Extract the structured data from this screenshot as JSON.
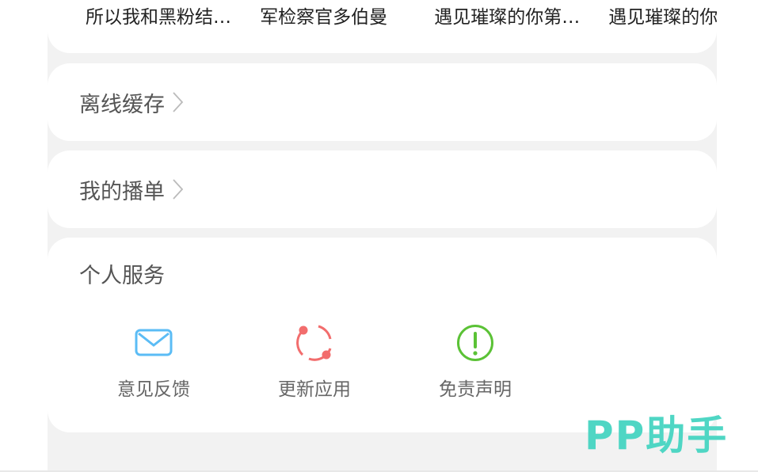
{
  "history": {
    "items": [
      "所以我和黑粉结婚了",
      "军检察官多伯曼",
      "遇见璀璨的你第一季",
      "遇见璀璨的你"
    ]
  },
  "menu": {
    "offline_label": "离线缓存",
    "playlist_label": "我的播单"
  },
  "service": {
    "title": "个人服务",
    "items": [
      {
        "label": "意见反馈",
        "icon": "mail-icon",
        "color": "#5bbcf5"
      },
      {
        "label": "更新应用",
        "icon": "refresh-icon",
        "color": "#f26d6d"
      },
      {
        "label": "免责声明",
        "icon": "alert-icon",
        "color": "#5bc236"
      }
    ]
  },
  "watermark": "PP助手"
}
